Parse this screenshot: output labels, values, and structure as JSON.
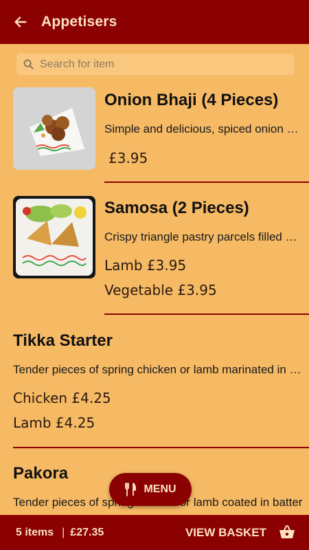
{
  "header": {
    "title": "Appetisers",
    "back_icon": "arrow-left-icon"
  },
  "search": {
    "placeholder": "Search for item",
    "value": "",
    "icon": "search-icon"
  },
  "items": [
    {
      "name": "Onion Bhaji (4 Pieces)",
      "description": "Simple and delicious, spiced onion bhajis",
      "prices": [
        {
          "label": "£3.95"
        }
      ]
    },
    {
      "name": "Samosa (2 Pieces)",
      "description": "Crispy triangle pastry parcels filled with spiced filling",
      "prices": [
        {
          "label": "Lamb £3.95"
        },
        {
          "label": "Vegetable £3.95"
        }
      ]
    },
    {
      "name": "Tikka Starter",
      "description": "Tender pieces of spring chicken or lamb marinated in spices",
      "prices": [
        {
          "label": "Chicken £4.25"
        },
        {
          "label": "Lamb £4.25"
        }
      ]
    },
    {
      "name": "Pakora",
      "description": "Tender pieces of spring chicken or lamb coated in batter",
      "prices": []
    }
  ],
  "menu_button": {
    "label": "MENU",
    "icon": "cutlery-icon"
  },
  "basket": {
    "items_label": "5 items",
    "separator": "|",
    "total": "£27.35",
    "view_label": "VIEW BASKET",
    "icon": "basket-icon"
  },
  "colors": {
    "primary": "#8b0000",
    "background": "#f6b964",
    "on_primary": "#fbe2c0"
  }
}
